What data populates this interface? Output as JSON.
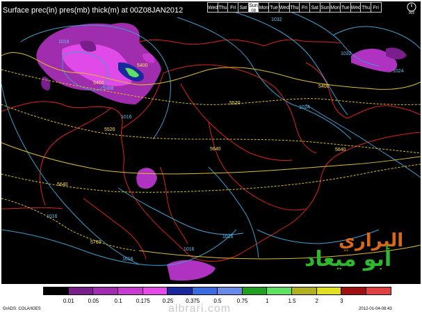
{
  "header": {
    "title": "Surface prec(in) pres(mb) thick(m) at 00Z08JAN2012"
  },
  "day_strip": {
    "days": [
      "Wed",
      "Thu",
      "Fri",
      "Sat",
      "Sun",
      "Mon",
      "Tue",
      "Wed",
      "Thu",
      "Fri",
      "Sat",
      "Sun",
      "Mon",
      "Tue",
      "Wed",
      "Thu",
      "Fri"
    ],
    "active_index": 4,
    "active_sub": "08"
  },
  "clock": {
    "label": "002"
  },
  "map": {
    "background": "#000000",
    "coast_color": "#e02020",
    "isobar_color": "#3aa0d0",
    "thickness_color": "#e0c020",
    "thickness_labels": [
      "5400",
      "5400",
      "5400",
      "5520",
      "5520",
      "5640",
      "5640",
      "5640",
      "5760"
    ],
    "isobar_labels": [
      "1016",
      "1008",
      "1016",
      "1024",
      "1032",
      "1024",
      "1016",
      "1016",
      "1016",
      "1016",
      "1032"
    ]
  },
  "colorbar": {
    "colors": [
      "#000000",
      "#7a1e8e",
      "#a02cb0",
      "#c83ad0",
      "#e64ae8",
      "#1a28a0",
      "#3a6ae0",
      "#6a8ae8",
      "#20a020",
      "#60e060",
      "#b0b020",
      "#e0e020",
      "#a01010",
      "#e04040"
    ],
    "labels": [
      "0.01",
      "0.05",
      "0.1",
      "0.175",
      "0.25",
      "0.375",
      "0.5",
      "0.75",
      "1",
      "1.5",
      "2",
      "3"
    ]
  },
  "footer": {
    "left": "GrADS: COLA/IGES",
    "right": "2012-01-04-08:43",
    "watermark": "albrari.com"
  },
  "logo": {
    "line1": "البراري",
    "line2": "أبو ميعاد"
  }
}
